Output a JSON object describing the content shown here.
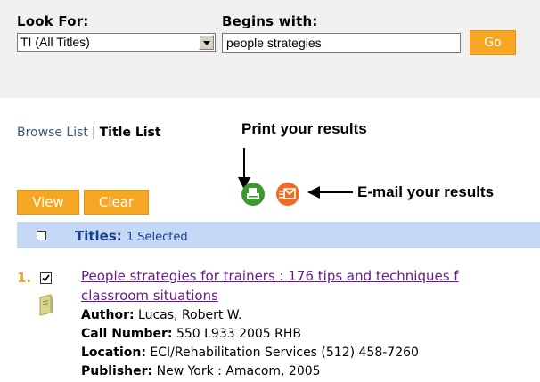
{
  "search": {
    "look_for_label": "Look For:",
    "look_for_value": "TI (All Titles)",
    "begins_with_label": "Begins with:",
    "begins_with_value": "people strategies",
    "go_label": "Go"
  },
  "nav": {
    "browse_list": "Browse List",
    "separator": "|",
    "title_list": "Title List"
  },
  "annotations": {
    "print": "Print your results",
    "email": "E-mail your results"
  },
  "toolbar": {
    "view_label": "View",
    "clear_label": "Clear"
  },
  "titles_header": {
    "label": "Titles:",
    "selected": "1 Selected"
  },
  "results": [
    {
      "number": "1.",
      "title_line1": "People strategies for trainers : 176 tips and techniques f",
      "title_line2": "classroom situations",
      "author_label": "Author:",
      "author": "Lucas, Robert W.",
      "call_number_label": "Call Number:",
      "call_number": "550 L933 2005 RHB",
      "location_label": "Location:",
      "location": "ECI/Rehabilitation Services (512) 458-7260",
      "publisher_label": "Publisher:",
      "publisher": "New York : Amacom, 2005"
    }
  ],
  "colors": {
    "orange": "#f5a623",
    "title_bar": "#c5d8f5",
    "print_icon": "#3c9a2c",
    "email_icon": "#f26a21",
    "link": "#6a1a8a"
  },
  "icons": {
    "print": "printer-icon",
    "email": "envelope-icon",
    "item_type": "book-icon"
  }
}
